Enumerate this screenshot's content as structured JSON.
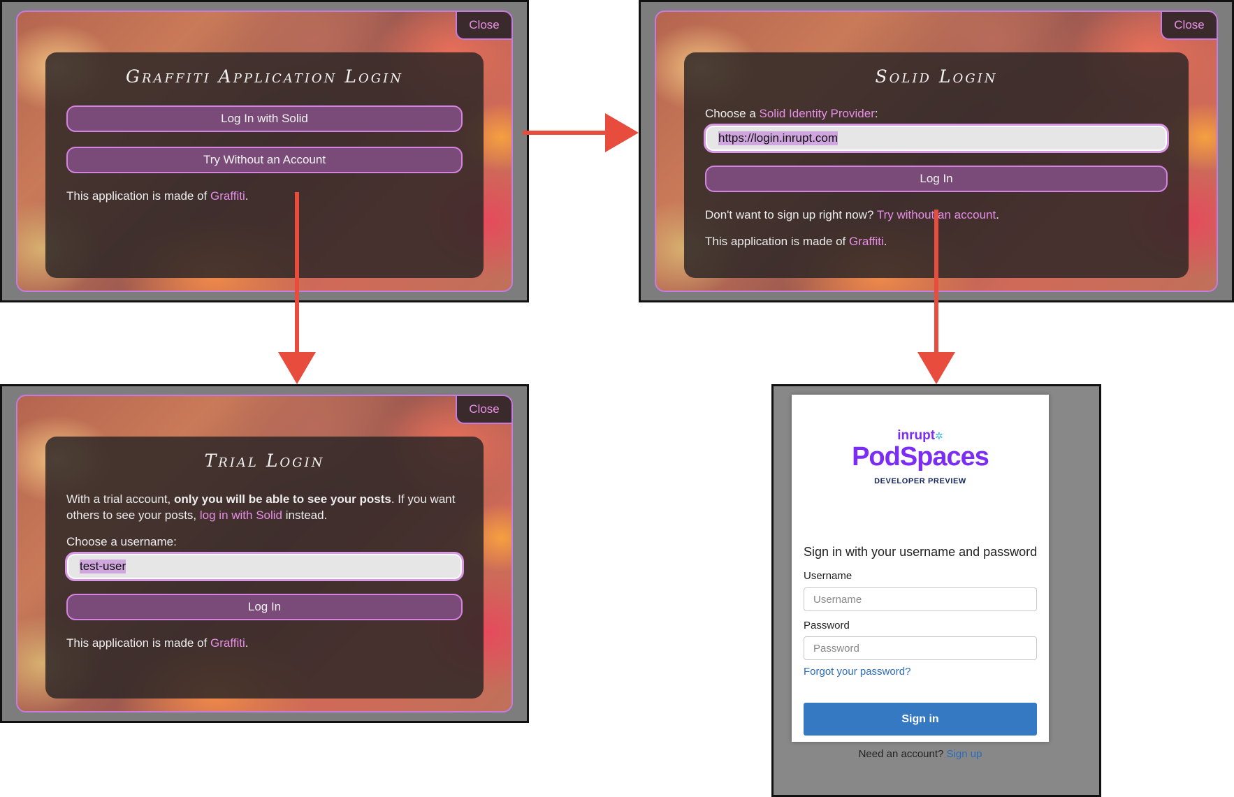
{
  "app_login": {
    "close": "Close",
    "title": "Graffiti Application Login",
    "solid_button": "Log In with Solid",
    "trial_button": "Try Without an Account",
    "made_of_prefix": "This application is made of ",
    "made_of_link": "Graffiti",
    "made_of_suffix": "."
  },
  "solid_login": {
    "close": "Close",
    "title": "Solid Login",
    "choose_prefix": "Choose a ",
    "choose_link": "Solid Identity Provider",
    "choose_suffix": ":",
    "provider_value": "https://login.inrupt.com",
    "login_button": "Log In",
    "no_signup_prefix": "Don't want to sign up right now? ",
    "no_signup_link": "Try without an account",
    "no_signup_suffix": ".",
    "made_of_prefix": "This application is made of ",
    "made_of_link": "Graffiti",
    "made_of_suffix": "."
  },
  "trial_login": {
    "close": "Close",
    "title": "Trial Login",
    "desc_1": "With a trial account, ",
    "desc_bold": "only you will be able to see your posts",
    "desc_2": ". If you want others to see your posts, ",
    "desc_link": "log in with Solid",
    "desc_3": " instead.",
    "username_label": "Choose a username:",
    "username_value": "test-user",
    "login_button": "Log In",
    "made_of_prefix": "This application is made of ",
    "made_of_link": "Graffiti",
    "made_of_suffix": "."
  },
  "podspaces": {
    "brand_small": "inrupt",
    "brand_big": "PodSpaces",
    "brand_sub": "DEVELOPER PREVIEW",
    "heading": "Sign in with your username and password",
    "username_label": "Username",
    "username_placeholder": "Username",
    "password_label": "Password",
    "password_placeholder": "Password",
    "forgot": "Forgot your password?",
    "signin": "Sign in",
    "need_account": "Need an account? ",
    "signup": "Sign up",
    "colors": {
      "brand_purple": "#7b2cf5",
      "brand_navy": "#13235b",
      "button_blue": "#3579c2",
      "link_blue": "#2a6ab8"
    }
  },
  "flow_arrow_color": "#e84c3d"
}
